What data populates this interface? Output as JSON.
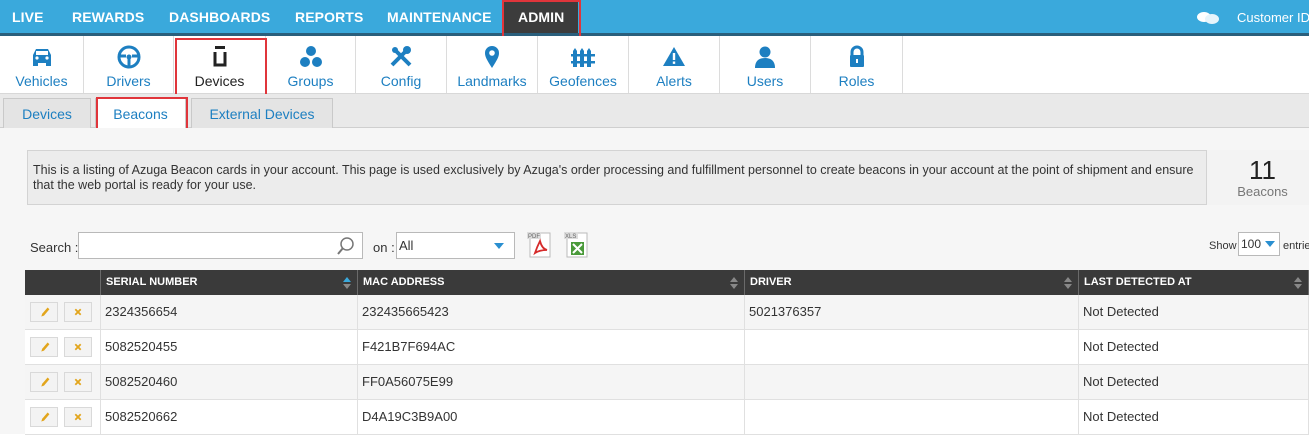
{
  "topnav": {
    "items": [
      "LIVE",
      "REWARDS",
      "DASHBOARDS",
      "REPORTS",
      "MAINTENANCE",
      "ADMIN"
    ],
    "active": "ADMIN",
    "customer_label": "Customer ID"
  },
  "toolbar": {
    "items": [
      {
        "label": "Vehicles",
        "icon": "car-icon"
      },
      {
        "label": "Drivers",
        "icon": "steering-wheel-icon"
      },
      {
        "label": "Devices",
        "icon": "device-icon"
      },
      {
        "label": "Groups",
        "icon": "groups-icon"
      },
      {
        "label": "Config",
        "icon": "tools-icon"
      },
      {
        "label": "Landmarks",
        "icon": "map-pin-icon"
      },
      {
        "label": "Geofences",
        "icon": "fence-icon"
      },
      {
        "label": "Alerts",
        "icon": "warning-icon"
      },
      {
        "label": "Users",
        "icon": "user-icon"
      },
      {
        "label": "Roles",
        "icon": "lock-icon"
      }
    ],
    "active": "Devices"
  },
  "subtabs": {
    "items": [
      "Devices",
      "Beacons",
      "External Devices"
    ],
    "active": "Beacons"
  },
  "info": {
    "text": "This is a listing of Azuga Beacon cards in your account. This page is used exclusively by Azuga's order processing and fulfillment personnel to create beacons in your account at the point of shipment and ensure that the web portal is ready for your use.",
    "count": "11",
    "count_label": "Beacons"
  },
  "filters": {
    "search_label": "Search :",
    "search_value": "",
    "on_label": "on :",
    "on_value": "All",
    "export_pdf_label": "PDF",
    "export_xls_label": "XLS",
    "show_label": "Show",
    "show_value": "100",
    "entries_label": "entries"
  },
  "table": {
    "columns": [
      "",
      "SERIAL NUMBER",
      "MAC ADDRESS",
      "DRIVER",
      "LAST DETECTED AT"
    ],
    "rows": [
      {
        "serial": "2324356654",
        "mac": "232435665423",
        "driver": "5021376357",
        "last": "Not Detected"
      },
      {
        "serial": "5082520455",
        "mac": "F421B7F694AC",
        "driver": "",
        "last": "Not Detected"
      },
      {
        "serial": "5082520460",
        "mac": "FF0A56075E99",
        "driver": "",
        "last": "Not Detected"
      },
      {
        "serial": "5082520662",
        "mac": "D4A19C3B9A00",
        "driver": "",
        "last": "Not Detected"
      }
    ]
  },
  "colors": {
    "topbar": "#3aa9dc",
    "active_nav": "#3c3c3c",
    "link_blue": "#1d7fc1",
    "highlight": "#e0353b",
    "table_header": "#3a3a3a"
  }
}
